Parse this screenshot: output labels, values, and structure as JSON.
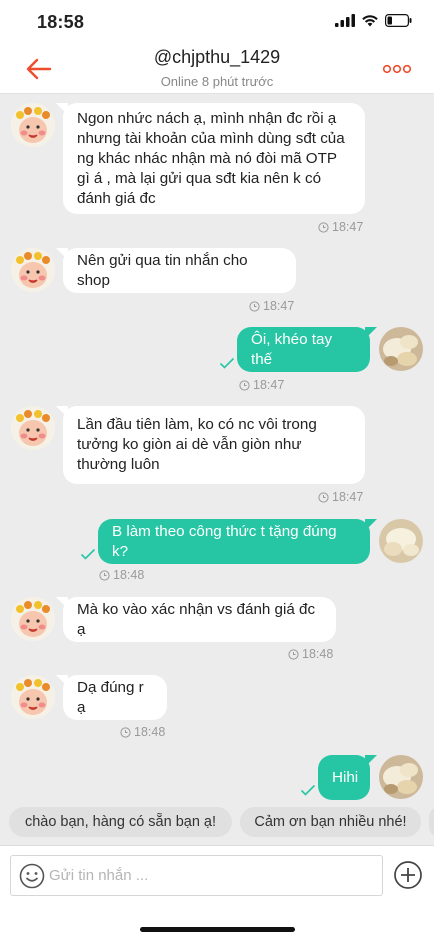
{
  "status_bar": {
    "time": "18:58"
  },
  "header": {
    "title": "@chjpthu_1429",
    "subtitle": "Online 8 phút trước",
    "colors": {
      "accent": "#ee4d2d"
    }
  },
  "messages": [
    {
      "side": "in",
      "text": "Ngon nhức nách ạ, mình nhận đc rồi ạ nhưng tài khoản của mình dùng sđt của ng khác nhác nhận mà nó đòi mã OTP gì á , mà lại gửi qua sđt kia nên k có đánh giá đc",
      "time": "18:47"
    },
    {
      "side": "in",
      "text": "Nên gửi qua tin nhắn cho shop",
      "time": "18:47"
    },
    {
      "side": "out",
      "text": "Ôi, khéo tay thế",
      "time": "18:47"
    },
    {
      "side": "in",
      "text": "Lần đầu tiên làm, ko có nc vôi trong tưởng ko giòn ai dè vẫn giòn như thường luôn",
      "time": "18:47"
    },
    {
      "side": "out",
      "text": "B làm theo công thức t tặng đúng k?",
      "time": "18:48"
    },
    {
      "side": "in",
      "text": "Mà ko vào xác nhận vs đánh giá đc ạ",
      "time": "18:48"
    },
    {
      "side": "in",
      "text": "Dạ đúng r ạ",
      "time": "18:48"
    },
    {
      "side": "out",
      "text": "Hihi",
      "time": ""
    }
  ],
  "quick_replies": [
    "chào bạn, hàng có sẵn bạn ạ!",
    "Cảm ơn bạn nhiều nhé!"
  ],
  "input": {
    "placeholder": "Gửi tin nhắn ..."
  },
  "colors": {
    "outgoing_bubble": "#26c6a4",
    "background": "#ececec"
  }
}
